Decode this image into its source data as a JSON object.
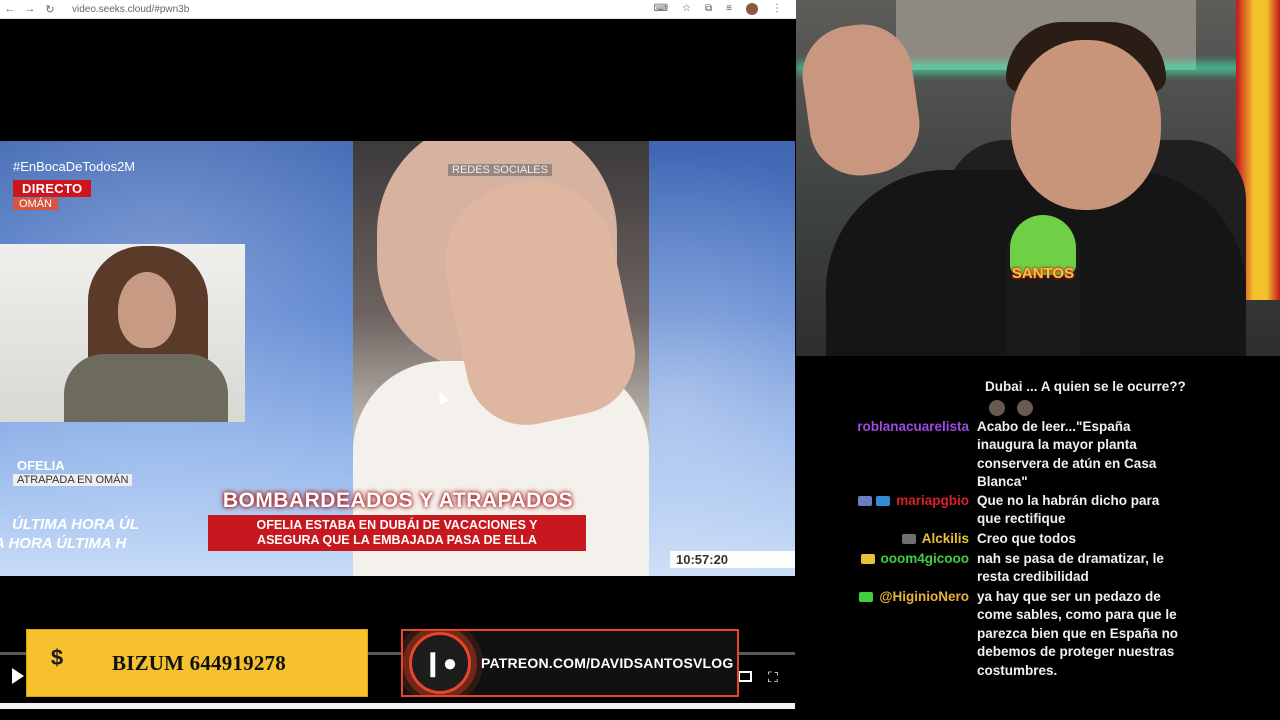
{
  "browser": {
    "url": "video.seeks.cloud/#pwn3b"
  },
  "broadcast": {
    "hashtag": "#EnBocaDeTodos2M",
    "live_label": "DIRECTO",
    "location_label": "OMÁN",
    "source_label": "REDES SOCIALES",
    "guest_name": "OFELIA",
    "guest_caption": "ATRAPADA EN OMÁN",
    "ticker_row1": "ÚLTIMA HORA   ÚL",
    "ticker_row2": "A HORA   ÚLTIMA H",
    "headline": "BOMBARDEADOS Y ATRAPADOS",
    "subheadline_line1": "OFELIA ESTABA EN DUBÁI DE VACACIONES Y",
    "subheadline_line2": "ASEGURA QUE LA EMBAJADA PASA DE ELLA",
    "clock": "10:57:20"
  },
  "overlays": {
    "bizum_symbol": "$",
    "bizum_text": "BIZUM 644919278",
    "patreon_text": "PATREON.COM/DAVIDSANTOSVLOG"
  },
  "webcam": {
    "mic_label": "SANTOS"
  },
  "chat": {
    "top_partial": "Dubai ... A quien se le ocurre??",
    "messages": [
      {
        "user": "roblanacuarelista",
        "color": "#9b4de0",
        "lines": [
          "Acabo de leer...\"España",
          "inaugura la mayor planta",
          "conservera de atún en Casa",
          "Blanca\""
        ]
      },
      {
        "user": "mariapgbio",
        "color": "#d8222a",
        "lines": [
          "Que no la habrán dicho para",
          "que rectifique"
        ]
      },
      {
        "user": "Alckilis",
        "color": "#e6c23a",
        "lines": [
          "Creo que todos"
        ]
      },
      {
        "user": "ooom4gicooo",
        "color": "#3fcf3f",
        "lines": [
          "nah se pasa de dramatizar, le",
          "resta credibilidad"
        ]
      },
      {
        "user": "@HiginioNero",
        "color": "#e8b43a",
        "lines": [
          "ya hay que ser un pedazo de",
          "come sables, como para que le",
          "parezca bien que en España no",
          "debemos de proteger nuestras",
          "costumbres."
        ]
      }
    ]
  }
}
